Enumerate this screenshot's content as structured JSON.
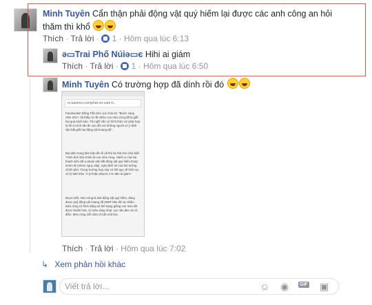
{
  "comments": [
    {
      "author": "Minh Tuyên",
      "text": "Cẩn thận phải động vật quý hiếm lại được các anh công an hỏi thăm thì khổ",
      "actions": {
        "like": "Thích",
        "reply": "Trả lời",
        "like_count": "1",
        "time": "Hôm qua lúc 6:13"
      }
    },
    {
      "author": "ә▭Trai Phố Núiә▭є",
      "text": "Hihi ai giám",
      "actions": {
        "like": "Thích",
        "reply": "Trả lời",
        "like_count": "1",
        "time": "Hôm qua lúc 6:50"
      }
    },
    {
      "author": "Minh Tuyên",
      "text": "Có trường hợp đã dính rồi đó",
      "actions": {
        "like": "Thích",
        "reply": "Trả lời",
        "time": "Hôm qua lúc 7:02"
      }
    }
  ],
  "screenshot": {
    "url": "m.baomoi.com/phat-no-cam-h...",
    "paragraphs": [
      "Facebooker Đồng Tiến bức xúc chia sẻ: \"Bước sang năm 2017, tôi thấy có rất nhiều con mèo rừng đã bị giết hại qua sách báo. Tôi nghĩ cần có hình thức xử phạt hợp lý để có tính răn đe cao đối với những người có ý định săn bắt giết hại động vật hoang dã\".",
      "Đại diện trung tâm bảo tồn lê xã thú ăn thịt nhỏ chia biết: \"Hình ảnh săn chính là con mèo rừng. Hành vi của hai thanh niên đã vi phạm săn bắt động vật quý hiếm thuộc nhóm IB (nhóm nguy cấp), nghị định 32 của thủ tướng chính phủ. Trong trường hợp này có thể quy về hình sự, xử lý 500 triệu -2 tỷ hoặc phạt tù 1-5 năm tù giam\".",
      "Được biết, mèo rừng là loài động vật quý hiếm, đang được quỹ động vật hoang dã WWF bảo tồn tự nhiên. Mèo rừng có hình dáng và thể trạng giống con mèo đã được thuần hóa, có màu vàng nhạt, sọc nâu đen và có đốm. Mèo rừng mỗi năm chỉ đẻ một lứa."
    ]
  },
  "more_replies": "Xem phản hồi khác",
  "reply_input": {
    "placeholder": "Viết trả lời..."
  }
}
